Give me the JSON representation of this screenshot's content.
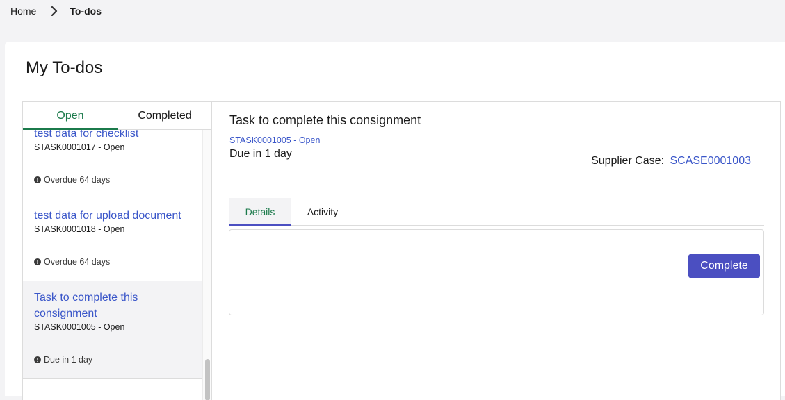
{
  "breadcrumb": {
    "home": "Home",
    "current": "To-dos"
  },
  "page": {
    "title": "My To-dos"
  },
  "list": {
    "tabs": [
      {
        "label": "Open",
        "active": true
      },
      {
        "label": "Completed",
        "active": false
      }
    ],
    "items": [
      {
        "title": "test data for checklist",
        "id_status": "STASK0001017 - Open",
        "status": "Overdue 64 days"
      },
      {
        "title": "test data for upload document",
        "id_status": "STASK0001018 - Open",
        "status": "Overdue 64 days"
      },
      {
        "title": "Task to complete this consignment",
        "id_status": "STASK0001005 - Open",
        "status": "Due in 1 day",
        "selected": true
      }
    ]
  },
  "detail": {
    "title": "Task to complete this consignment",
    "id_link": "STASK0001005 - Open",
    "due": "Due in 1 day",
    "supplier_case_label": "Supplier Case:",
    "supplier_case_value": "SCASE0001003",
    "tabs": [
      {
        "label": "Details",
        "active": true
      },
      {
        "label": "Activity",
        "active": false
      }
    ],
    "complete_label": "Complete"
  },
  "colors": {
    "accent_green": "#1b7a4b",
    "link_blue": "#3a56c9",
    "primary_button": "#4b4fc1"
  }
}
